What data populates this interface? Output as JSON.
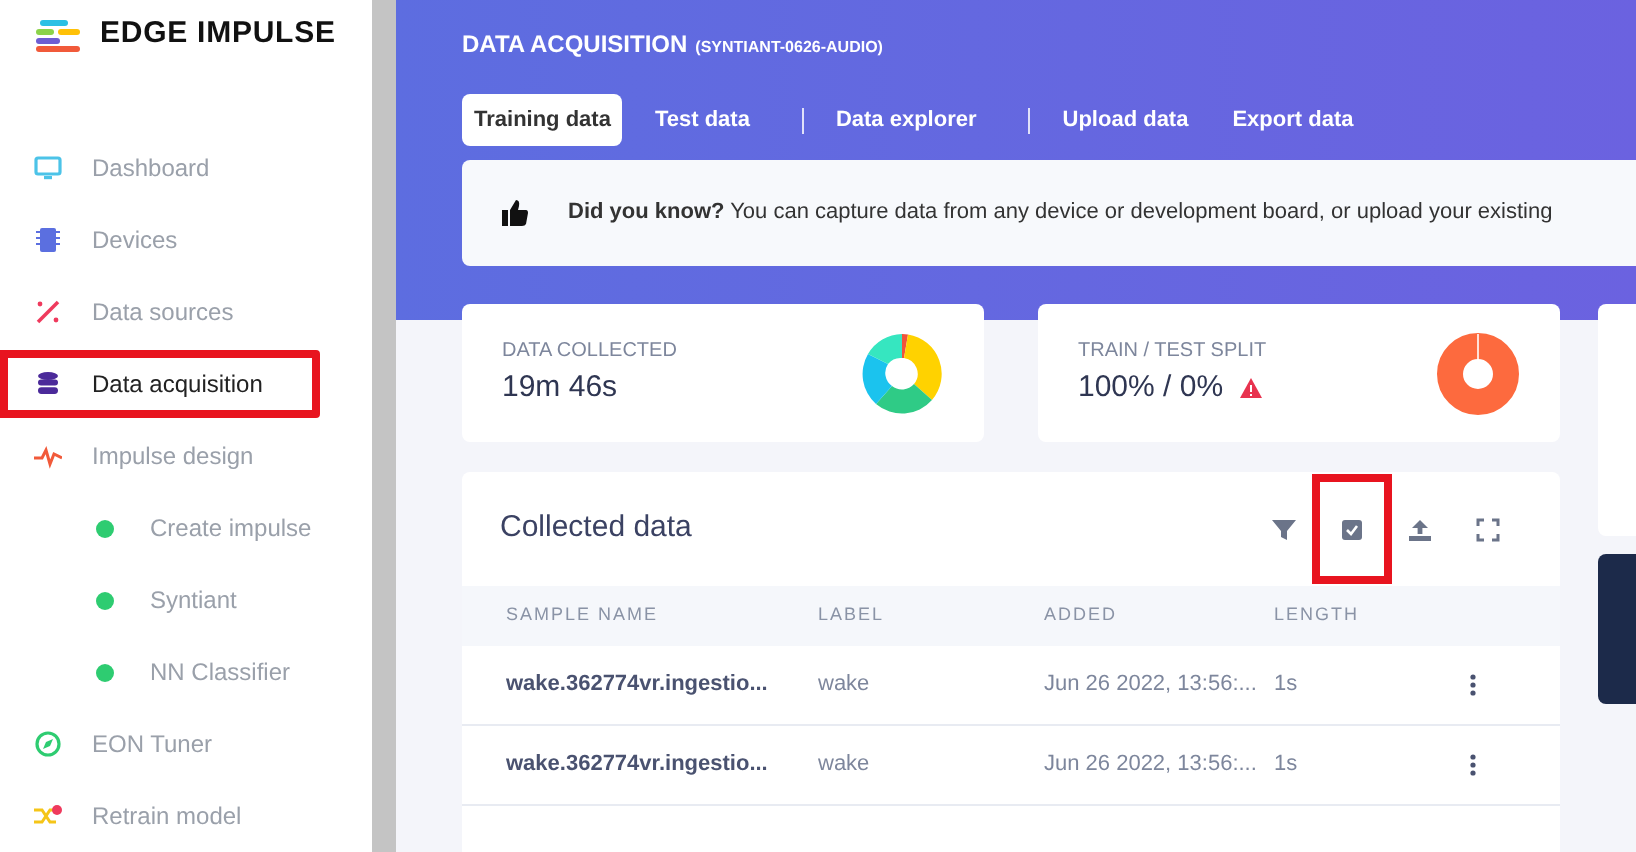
{
  "sidebar": {
    "logo": "EDGE IMPULSE",
    "items": [
      {
        "kind": "item",
        "label": "Dashboard",
        "selected": false,
        "highlighted": false
      },
      {
        "kind": "item",
        "label": "Devices",
        "selected": false,
        "highlighted": false
      },
      {
        "kind": "item",
        "label": "Data sources",
        "selected": false,
        "highlighted": false
      },
      {
        "kind": "item",
        "label": "Data acquisition",
        "selected": true,
        "highlighted": true
      },
      {
        "kind": "item",
        "label": "Impulse design",
        "selected": false,
        "highlighted": false
      },
      {
        "kind": "subitem",
        "label": "Create impulse",
        "selected": false,
        "highlighted": false
      },
      {
        "kind": "subitem",
        "label": "Syntiant",
        "selected": false,
        "highlighted": false
      },
      {
        "kind": "subitem",
        "label": "NN Classifier",
        "selected": false,
        "highlighted": false
      },
      {
        "kind": "item",
        "label": "EON Tuner",
        "selected": false,
        "highlighted": false
      },
      {
        "kind": "item",
        "label": "Retrain model",
        "selected": false,
        "highlighted": false
      }
    ]
  },
  "header": {
    "title": "DATA ACQUISITION",
    "subtitle": "(SYNTIANT-0626-AUDIO)",
    "tab_groups": [
      [
        {
          "label": "Training data",
          "selected": true
        },
        {
          "label": "Test data",
          "selected": false
        }
      ],
      [
        {
          "label": "Data explorer",
          "selected": false
        }
      ],
      [
        {
          "label": "Upload data",
          "selected": false
        },
        {
          "label": "Export data",
          "selected": false
        }
      ]
    ]
  },
  "tip": {
    "text": "**Did you know?** You can capture data from any device or development board, or upload your existing"
  },
  "stats": [
    {
      "label": "DATA COLLECTED",
      "value": "19m 46s",
      "warning": false,
      "kind": "labels"
    },
    {
      "label": "TRAIN / TEST SPLIT",
      "value": "100% / 0%",
      "warning": true,
      "kind": "split"
    }
  ],
  "collected": {
    "title": "Collected data",
    "tools": [
      {
        "kind": "filter",
        "highlighted": false
      },
      {
        "kind": "select",
        "highlighted": true
      },
      {
        "kind": "upload",
        "highlighted": false
      },
      {
        "kind": "expand",
        "highlighted": false
      }
    ],
    "columns": [
      "SAMPLE NAME",
      "LABEL",
      "ADDED",
      "LENGTH"
    ],
    "rows": [
      {
        "name": "wake.362774vr.ingestio...",
        "label": "wake",
        "added": "Jun 26 2022, 13:56:...",
        "length": "1s"
      },
      {
        "name": "wake.362774vr.ingestio...",
        "label": "wake",
        "added": "Jun 26 2022, 13:56:...",
        "length": "1s"
      }
    ]
  }
}
